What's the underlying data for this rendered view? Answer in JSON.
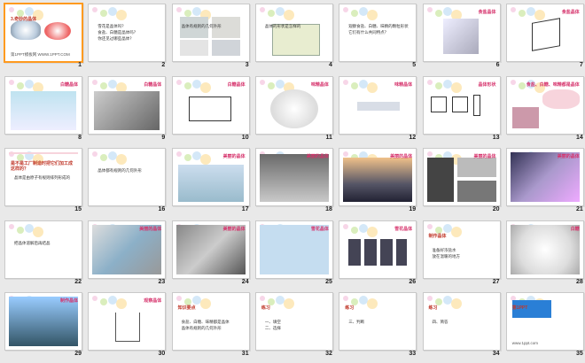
{
  "slides": [
    {
      "number": "1",
      "title": "3.奇妙的晶体",
      "subtitle": "第1PPT模板网 WWW.1PPT.COM"
    },
    {
      "number": "2",
      "bullets": [
        "雪花是晶体吗？",
        "食盐、白糖是晶体吗？",
        "你还见过哪些晶体？"
      ]
    },
    {
      "number": "3",
      "bullets": [
        "晶体有规则的几何外形"
      ]
    },
    {
      "number": "4",
      "bullets": [
        "晶体的形状是怎样的"
      ]
    },
    {
      "number": "5",
      "bullets": [
        "观察食盐、白糖、味精的颗粒形状",
        "它们有什么共同特点？"
      ]
    },
    {
      "number": "6",
      "label": "食盐晶体"
    },
    {
      "number": "7",
      "label": "食盐晶体"
    },
    {
      "number": "8",
      "label": "白糖晶体"
    },
    {
      "number": "9",
      "label": "白糖晶体"
    },
    {
      "number": "10",
      "label": "白糖晶体"
    },
    {
      "number": "11",
      "label": "味精晶体"
    },
    {
      "number": "12",
      "label": "味精晶体"
    },
    {
      "number": "13",
      "label": "晶体形状"
    },
    {
      "number": "14",
      "label": "食盐、白糖、味精都是晶体"
    },
    {
      "number": "15",
      "title": "是不是工厂制造时把它们加工成这样的？",
      "bullets": [
        "晶体是由原子有规则排列形成的"
      ]
    },
    {
      "number": "16",
      "bullets": [
        "晶体都有规则的几何外形"
      ]
    },
    {
      "number": "17",
      "label": "美丽的晶体"
    },
    {
      "number": "18",
      "label": "美丽的晶体"
    },
    {
      "number": "19",
      "label": "美丽的晶体"
    },
    {
      "number": "20",
      "label": "美丽的晶体"
    },
    {
      "number": "21",
      "label": "美丽的晶体"
    },
    {
      "number": "22",
      "bullets": [
        "把晶体溶解后再结晶"
      ]
    },
    {
      "number": "23",
      "label": "美丽的晶体"
    },
    {
      "number": "24",
      "label": "美丽的晶体"
    },
    {
      "number": "25",
      "label": "雪花晶体"
    },
    {
      "number": "26",
      "label": "雪花晶体"
    },
    {
      "number": "27",
      "title": "制作晶体",
      "bullets": [
        "准备好浓盐水",
        "放在温暖的地方"
      ]
    },
    {
      "number": "28",
      "label": "白糖"
    },
    {
      "number": "29",
      "label": "制作晶体"
    },
    {
      "number": "30",
      "label": "观察晶体"
    },
    {
      "number": "31",
      "title": "知识要点",
      "bullets": [
        "食盐、白糖、味精都是晶体",
        "晶体有规则的几何外形"
      ]
    },
    {
      "number": "32",
      "title": "练习",
      "bullets": [
        "一、填空",
        "二、选择"
      ]
    },
    {
      "number": "33",
      "title": "练习",
      "bullets": [
        "三、判断"
      ]
    },
    {
      "number": "34",
      "title": "练习",
      "bullets": [
        "四、简答"
      ]
    },
    {
      "number": "35",
      "title": "第1PPT",
      "subtitle": "www.1ppt.com"
    }
  ],
  "selected_slide": "1",
  "colors": {
    "background": "#e9e9e9",
    "selection": "#ff9a1f",
    "accent": "#c0392b"
  }
}
